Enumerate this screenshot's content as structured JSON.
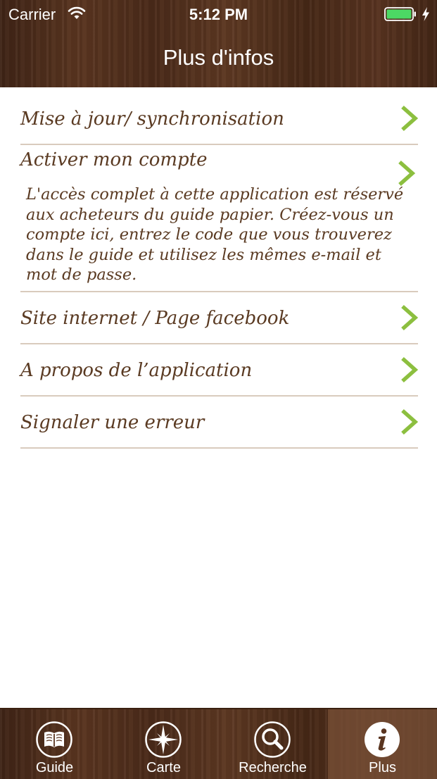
{
  "status_bar": {
    "carrier": "Carrier",
    "time": "5:12 PM",
    "battery_color": "#4cd964"
  },
  "nav": {
    "title": "Plus d'infos"
  },
  "list": {
    "items": [
      {
        "label": "Mise à jour/ synchronisation"
      },
      {
        "label": "Activer mon compte",
        "description": "L'accès complet à cette application est réservé aux acheteurs du guide papier. Créez-vous un compte ici, entrez le code que vous trouverez dans le guide et utilisez les mêmes e-mail et mot de passe."
      },
      {
        "label": "Site internet / Page facebook"
      },
      {
        "label": "A propos de l’application"
      },
      {
        "label": "Signaler une erreur"
      }
    ],
    "chevron_color": "#8cbf3f",
    "text_color": "#5a3a22"
  },
  "tabbar": {
    "tabs": [
      {
        "label": "Guide",
        "icon": "book-icon",
        "selected": false
      },
      {
        "label": "Carte",
        "icon": "compass-icon",
        "selected": false
      },
      {
        "label": "Recherche",
        "icon": "magnifier-icon",
        "selected": false
      },
      {
        "label": "Plus",
        "icon": "info-icon",
        "selected": true
      }
    ]
  }
}
